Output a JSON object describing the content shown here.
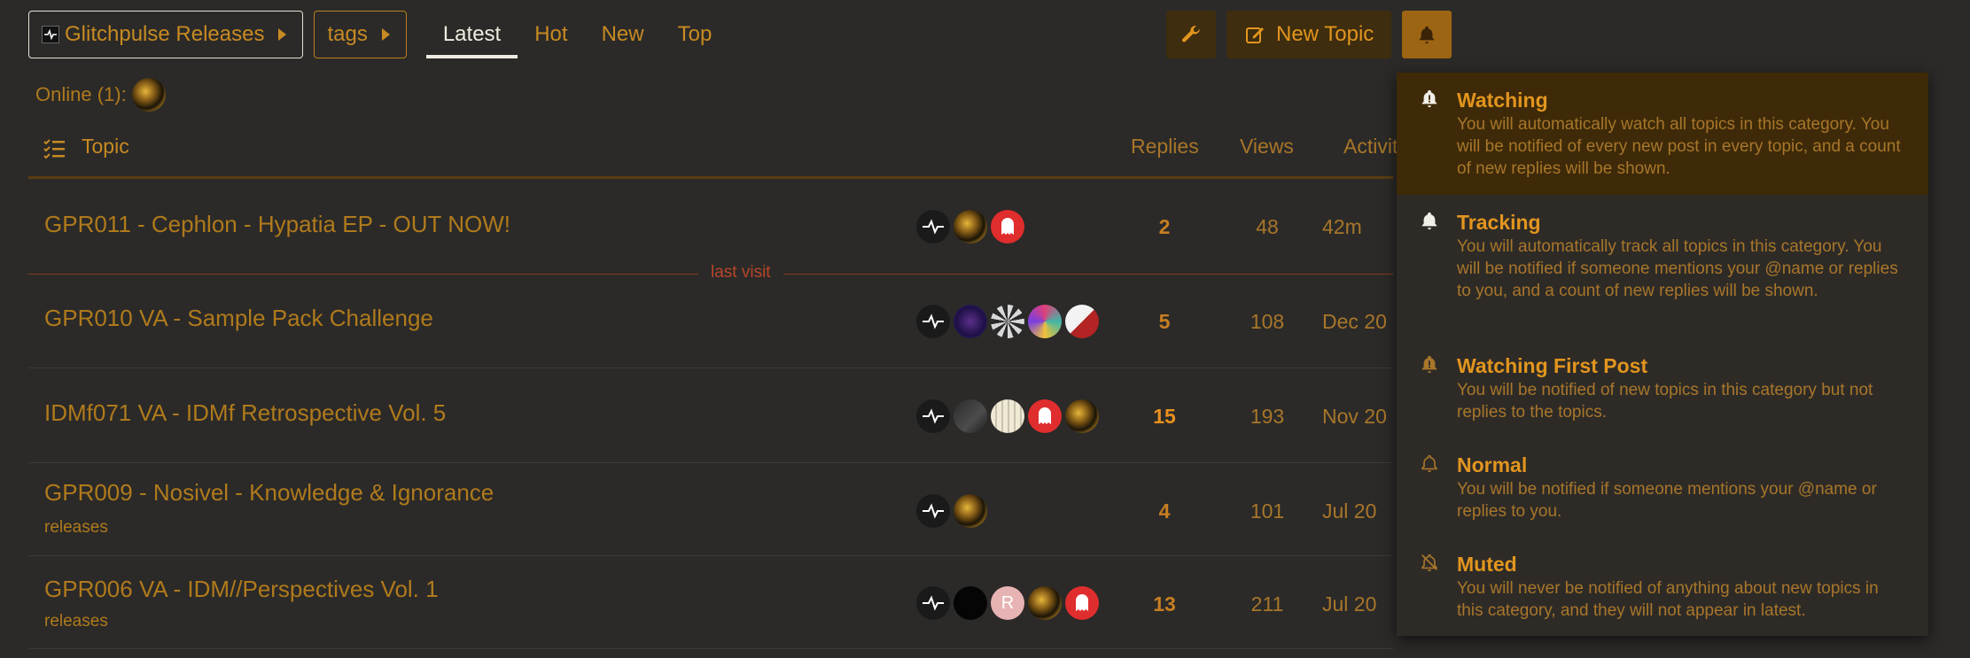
{
  "nav": {
    "category": "Glitchpulse Releases",
    "tags": "tags",
    "tabs": [
      "Latest",
      "Hot",
      "New",
      "Top"
    ],
    "new_topic": "New Topic"
  },
  "online_label": "Online (1):",
  "table": {
    "headers": {
      "topic": "Topic",
      "replies": "Replies",
      "views": "Views",
      "activity": "Activity"
    },
    "last_visit": "last visit",
    "rows": [
      {
        "title": "GPR011 - Cephlon - Hypatia EP - OUT NOW!",
        "tag": "",
        "replies": "2",
        "views": "48",
        "activity": "42m"
      },
      {
        "title": "GPR010 VA - Sample Pack Challenge",
        "tag": "",
        "replies": "5",
        "views": "108",
        "activity": "Dec 20"
      },
      {
        "title": "IDMf071 VA - IDMf Retrospective Vol. 5",
        "tag": "",
        "replies": "15",
        "views": "193",
        "activity": "Nov 20"
      },
      {
        "title": "GPR009 - Nosivel - Knowledge & Ignorance",
        "tag": "releases",
        "replies": "4",
        "views": "101",
        "activity": "Jul 20"
      },
      {
        "title": "GPR006 VA - IDM//Perspectives Vol. 1",
        "tag": "releases",
        "replies": "13",
        "views": "211",
        "activity": "Jul 20"
      }
    ],
    "poster_avatar_initial": "R"
  },
  "notifications": [
    {
      "name": "Watching",
      "desc": "You will automatically watch all topics in this category. You will be notified of every new post in every topic, and a count of new replies will be shown.",
      "icon": "bell-filled-icon",
      "selected": true
    },
    {
      "name": "Tracking",
      "desc": "You will automatically track all topics in this category. You will be notified if someone mentions your @name or replies to you, and a count of new replies will be shown.",
      "icon": "bell-icon",
      "selected": false
    },
    {
      "name": "Watching First Post",
      "desc": "You will be notified of new topics in this category but not replies to the topics.",
      "icon": "bell-exclamation-icon",
      "selected": false
    },
    {
      "name": "Normal",
      "desc": "You will be notified if someone mentions your @name or replies to you.",
      "icon": "bell-outline-icon",
      "selected": false
    },
    {
      "name": "Muted",
      "desc": "You will never be notified of anything about new topics in this category, and they will not appear in latest.",
      "icon": "bell-slash-icon",
      "selected": false
    }
  ],
  "colors": {
    "accent": "#e2951e",
    "background": "#2b2a28",
    "selected": "#3e2a08"
  }
}
